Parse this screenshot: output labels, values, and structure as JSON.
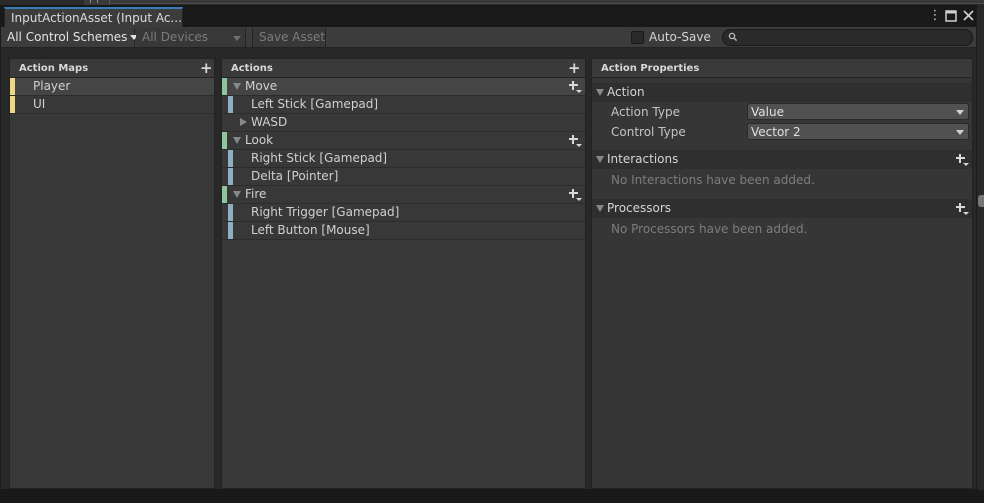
{
  "window": {
    "tab_title": "InputActionAsset (Input Ac...",
    "controls": [
      "more-icon",
      "maximize-icon",
      "close-icon"
    ]
  },
  "toolbar": {
    "control_schemes": "All Control Schemes",
    "devices": "All Devices",
    "save_asset": "Save Asset",
    "auto_save_label": "Auto-Save",
    "auto_save_checked": false,
    "search_value": ""
  },
  "action_maps": {
    "header": "Action Maps",
    "items": [
      {
        "label": "Player",
        "selected": true
      },
      {
        "label": "UI",
        "selected": false
      }
    ]
  },
  "actions": {
    "header": "Actions",
    "items": [
      {
        "label": "Move",
        "bindings": [
          {
            "label": "Left Stick [Gamepad]",
            "composite": false
          },
          {
            "label": "WASD",
            "composite": true
          }
        ]
      },
      {
        "label": "Look",
        "bindings": [
          {
            "label": "Right Stick [Gamepad]",
            "composite": false
          },
          {
            "label": "Delta [Pointer]",
            "composite": false
          }
        ]
      },
      {
        "label": "Fire",
        "bindings": [
          {
            "label": "Right Trigger [Gamepad]",
            "composite": false
          },
          {
            "label": "Left Button [Mouse]",
            "composite": false
          }
        ]
      }
    ]
  },
  "properties": {
    "header": "Action Properties",
    "action_section": "Action",
    "action_type_label": "Action Type",
    "action_type_value": "Value",
    "control_type_label": "Control Type",
    "control_type_value": "Vector 2",
    "interactions_section": "Interactions",
    "interactions_empty": "No Interactions have been added.",
    "processors_section": "Processors",
    "processors_empty": "No Processors have been added."
  },
  "colors": {
    "map_bar": "#f0d883",
    "action_bar": "#8dc59c",
    "binding_bar": "#8cb0c0",
    "tab_accent": "#3a79bb"
  }
}
